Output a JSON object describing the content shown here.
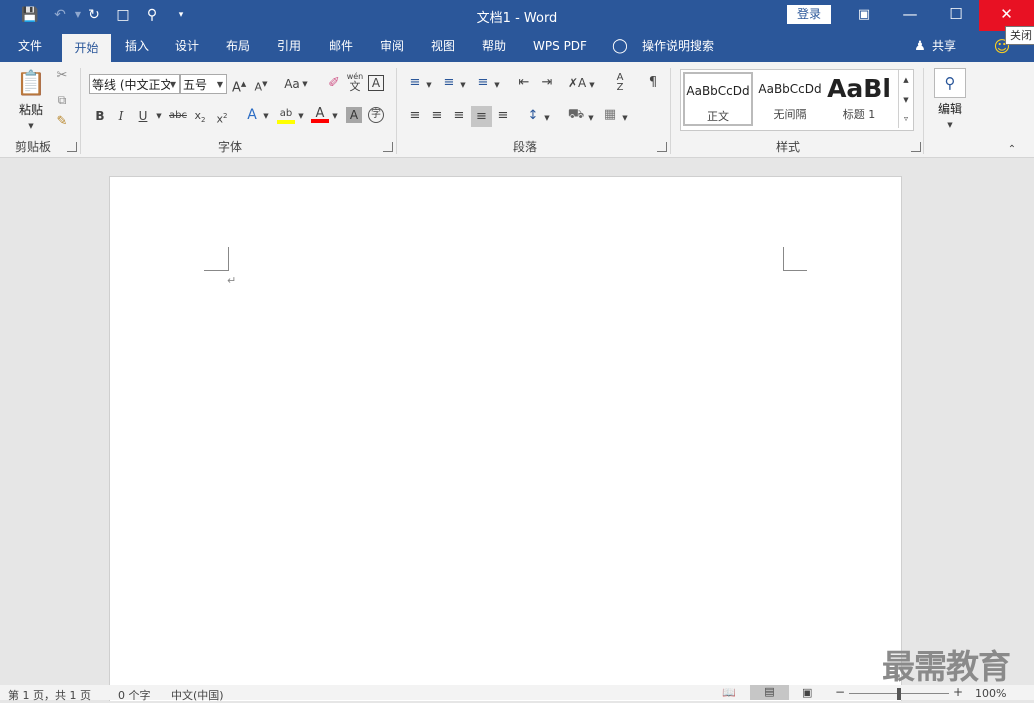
{
  "window": {
    "title": "文档1  -  Word",
    "login_label": "登录",
    "close_tooltip": "关闭"
  },
  "ribbon": {
    "tabs": [
      "文件",
      "开始",
      "插入",
      "设计",
      "布局",
      "引用",
      "邮件",
      "审阅",
      "视图",
      "帮助",
      "WPS PDF"
    ],
    "active_tab": "开始",
    "tell_me": "操作说明搜索",
    "share_label": "共享",
    "groups": {
      "clipboard": "剪贴板",
      "font": "字体",
      "paragraph": "段落",
      "styles": "样式",
      "editing": "编辑"
    },
    "paste_label": "粘贴",
    "font_name": "等线 (中文正文",
    "font_size": "五号",
    "change_case": "Aa",
    "phonetic": "wén",
    "styles_gallery": [
      {
        "sample": "AaBbCcDd",
        "name": "正文",
        "selected": true
      },
      {
        "sample": "AaBbCcDd",
        "name": "无间隔",
        "selected": false
      },
      {
        "sample": "AaBl",
        "name": "标题 1",
        "selected": false
      }
    ]
  },
  "document": {
    "paragraph_mark": "↵"
  },
  "status": {
    "page": "第 1 页，共 1 页",
    "words": "0 个字",
    "language": "中文(中国)",
    "zoom": "100%"
  },
  "watermark": "最需教育",
  "colors": {
    "accent": "#2b579a",
    "close": "#e81123",
    "highlight": "#ffff00",
    "font_color": "#ff0000"
  }
}
